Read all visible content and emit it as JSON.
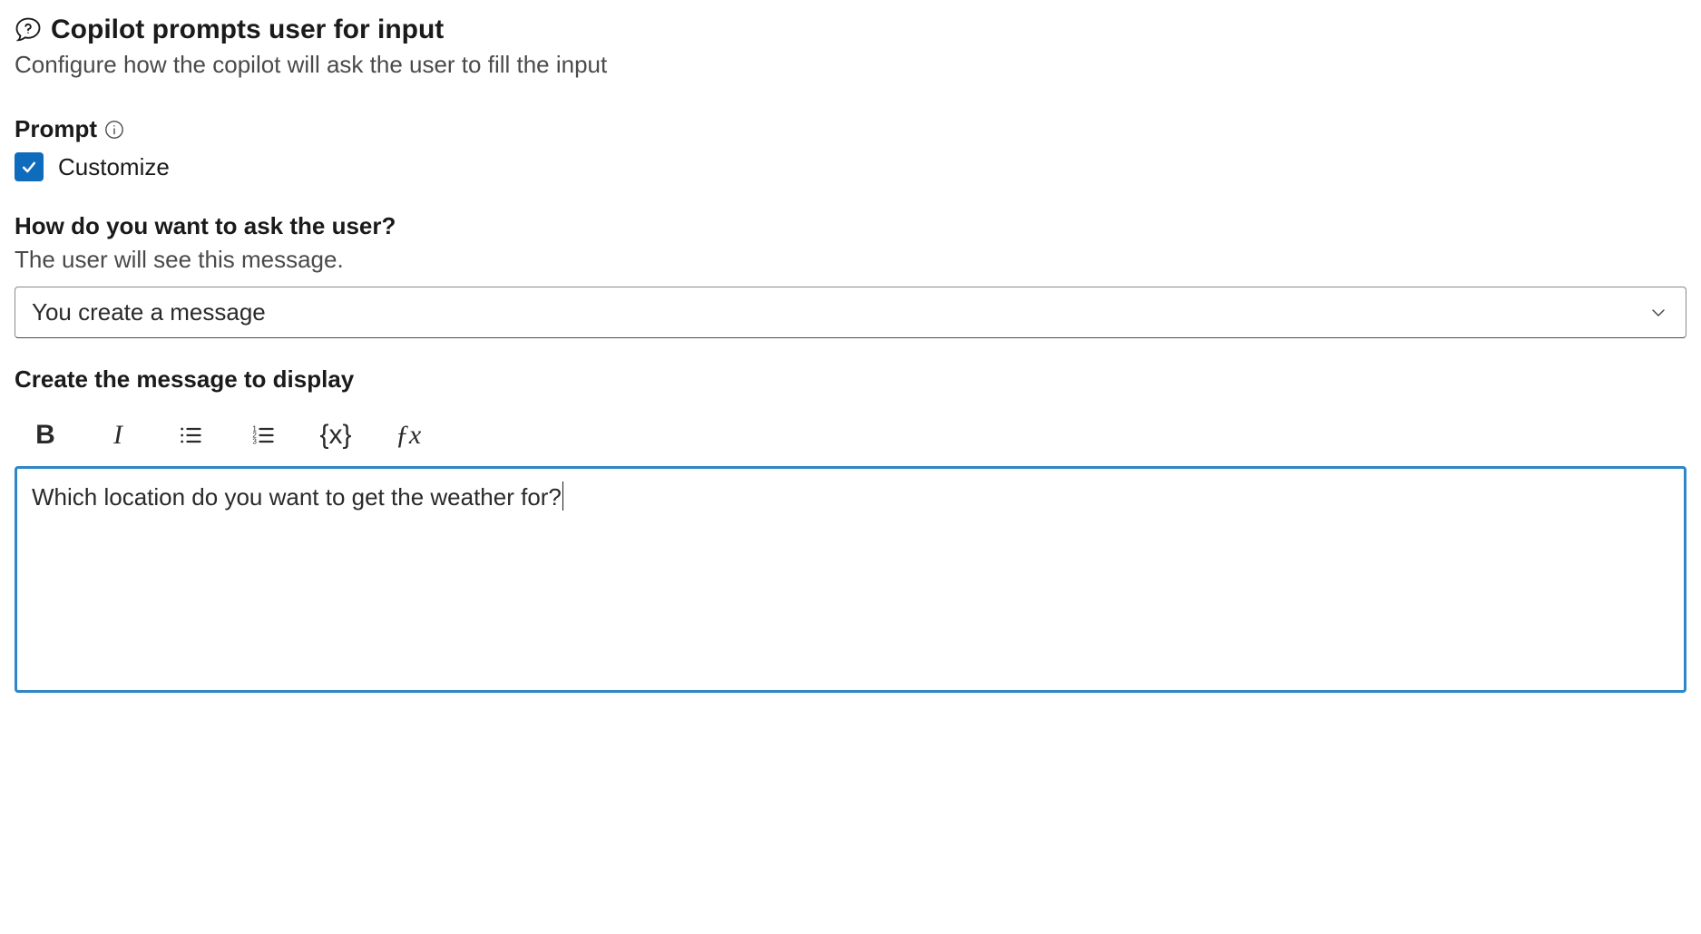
{
  "header": {
    "title": "Copilot prompts user for input",
    "subtitle": "Configure how the copilot will ask the user to fill the input"
  },
  "prompt_section": {
    "label": "Prompt",
    "checkbox_label": "Customize",
    "checked": true
  },
  "ask_section": {
    "label": "How do you want to ask the user?",
    "desc": "The user will see this message.",
    "dropdown_value": "You create a message"
  },
  "editor_section": {
    "label": "Create the message to display",
    "content": "Which location do you want to get the weather for?"
  },
  "toolbar": {
    "bold": "B",
    "italic": "I",
    "variable": "{x}",
    "fx": "ƒx"
  }
}
